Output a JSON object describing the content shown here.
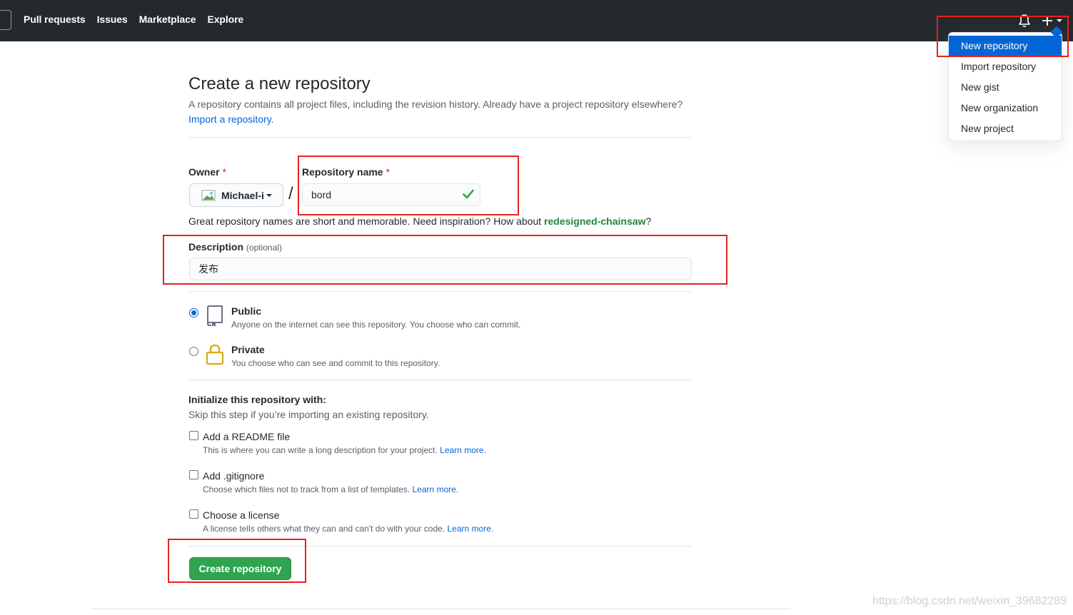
{
  "header": {
    "nav": [
      "Pull requests",
      "Issues",
      "Marketplace",
      "Explore"
    ]
  },
  "dropdown": {
    "items": [
      "New repository",
      "Import repository",
      "New gist",
      "New organization",
      "New project"
    ],
    "active_index": 0
  },
  "page": {
    "title": "Create a new repository",
    "subtitle": "A repository contains all project files, including the revision history. Already have a project repository elsewhere?",
    "import_link": "Import a repository",
    "import_suffix": "."
  },
  "owner": {
    "label": "Owner",
    "required": "*",
    "value": "Michael-i"
  },
  "slash": "/",
  "repo_name": {
    "label": "Repository name",
    "required": "*",
    "value": "bord"
  },
  "name_hint": {
    "text": "Great repository names are short and memorable. Need inspiration? How about ",
    "suggestion": "redesigned-chainsaw",
    "suffix": "?"
  },
  "description": {
    "label": "Description",
    "optional": "(optional)",
    "value": "发布"
  },
  "visibility": [
    {
      "title": "Public",
      "desc": "Anyone on the internet can see this repository. You choose who can commit.",
      "checked": true
    },
    {
      "title": "Private",
      "desc": "You choose who can see and commit to this repository.",
      "checked": false
    }
  ],
  "init": {
    "title": "Initialize this repository with:",
    "subtitle": "Skip this step if you’re importing an existing repository.",
    "options": [
      {
        "title": "Add a README file",
        "desc": "This is where you can write a long description for your project.",
        "link": "Learn more."
      },
      {
        "title": "Add .gitignore",
        "desc": "Choose which files not to track from a list of templates.",
        "link": "Learn more."
      },
      {
        "title": "Choose a license",
        "desc": "A license tells others what they can and can't do with your code.",
        "link": "Learn more."
      }
    ]
  },
  "create_button": "Create repository",
  "watermark": "https://blog.csdn.net/weixin_39682289",
  "colors": {
    "header_bg": "#24292e",
    "link": "#0366d6",
    "primary_button": "#2ea44f",
    "annotation": "#e8201f",
    "suggestion": "#22863a"
  }
}
